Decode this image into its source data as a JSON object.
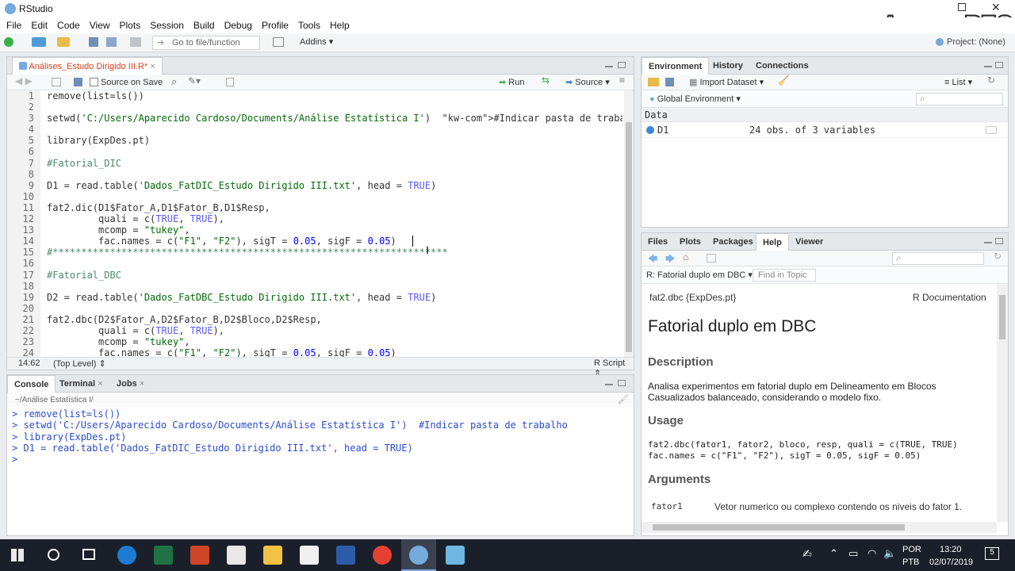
{
  "window": {
    "title": "RStudio",
    "project": "Project: (None)",
    "watermark": "ApowerREC"
  },
  "menu": [
    "File",
    "Edit",
    "Code",
    "View",
    "Plots",
    "Session",
    "Build",
    "Debug",
    "Profile",
    "Tools",
    "Help"
  ],
  "toolbar": {
    "goto_placeholder": "Go to file/function",
    "addins": "Addins"
  },
  "editor": {
    "tab_label": "Análises_Estudo Dirigido III.R*",
    "source_on_save": "Source on Save",
    "run": "Run",
    "source": "Source",
    "status_pos": "14:62",
    "status_scope": "(Top Level)",
    "status_lang": "R Script",
    "line_numbers": [
      "1",
      "2",
      "3",
      "4",
      "5",
      "6",
      "7",
      "8",
      "9",
      "10",
      "11",
      "12",
      "13",
      "14",
      "15",
      "16",
      "17",
      "18",
      "19",
      "20",
      "21",
      "22",
      "23",
      "24"
    ],
    "lines": [
      "remove(list=ls())",
      "",
      "setwd('C:/Users/Aparecido Cardoso/Documents/Análise Estatística I')  #Indicar pasta de trabalho",
      "",
      "library(ExpDes.pt)",
      "",
      "#Fatorial_DIC",
      "",
      "D1 = read.table('Dados_FatDIC_Estudo Dirigido III.txt', head = TRUE)",
      "",
      "fat2.dic(D1$Fator_A,D1$Fator_B,D1$Resp,",
      "         quali = c(TRUE, TRUE),",
      "         mcomp = \"tukey\",",
      "         fac.names = c(\"F1\", \"F2\"), sigT = 0.05, sigF = 0.05)",
      "#*********************************************************************",
      "",
      "#Fatorial_DBC",
      "",
      "D2 = read.table('Dados_FatDBC_Estudo Dirigido III.txt', head = TRUE)",
      "",
      "fat2.dbc(D2$Fator_A,D2$Fator_B,D2$Bloco,D2$Resp,",
      "         quali = c(TRUE, TRUE),",
      "         mcomp = \"tukey\",",
      "         fac.names = c(\"F1\", \"F2\"), sigT = 0.05, sigF = 0.05)"
    ]
  },
  "console": {
    "tabs": [
      "Console",
      "Terminal",
      "Jobs"
    ],
    "path": "~/Análise Estatística I/",
    "lines": [
      "> remove(list=ls())",
      "> setwd('C:/Users/Aparecido Cardoso/Documents/Análise Estatística I')  #Indicar pasta de trabalho",
      "> library(ExpDes.pt)",
      "> D1 = read.table('Dados_FatDIC_Estudo Dirigido III.txt', head = TRUE)",
      ">"
    ]
  },
  "environment": {
    "tabs": [
      "Environment",
      "History",
      "Connections"
    ],
    "import_dataset": "Import Dataset",
    "list": "List",
    "scope": "Global Environment",
    "section": "Data",
    "rows": [
      {
        "name": "D1",
        "value": "24 obs. of 3 variables"
      }
    ]
  },
  "help": {
    "tabs": [
      "Files",
      "Plots",
      "Packages",
      "Help",
      "Viewer"
    ],
    "topic": "R: Fatorial duplo em DBC",
    "find_placeholder": "Find in Topic",
    "header_left": "fat2.dbc {ExpDes.pt}",
    "header_right": "R Documentation",
    "title": "Fatorial duplo em DBC",
    "description_h": "Description",
    "description": "Analisa experimentos em fatorial duplo em Delineamento em Blocos Casualizados balanceado, considerando o modelo fixo.",
    "usage_h": "Usage",
    "usage_1": "fat2.dbc(fator1, fator2, bloco, resp, quali = c(TRUE, TRUE)",
    "usage_2": "fac.names = c(\"F1\", \"F2\"), sigT = 0.05, sigF = 0.05)",
    "arguments_h": "Arguments",
    "arg_name": "fator1",
    "arg_desc": "Vetor numerico ou complexo contendo os niveis do fator 1."
  },
  "taskbar": {
    "lang_top": "POR",
    "lang_bottom": "PTB",
    "time": "13:20",
    "date": "02/07/2019",
    "notifications": "5"
  }
}
